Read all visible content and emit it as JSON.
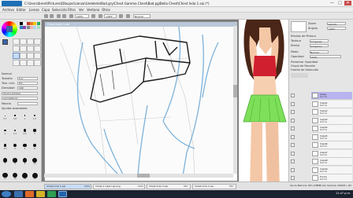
{
  "app": {
    "logo": "PaintTool SAI",
    "title": "C:\\Users\\brent\\Pictures\\Dibujos\\Lienzo\\Undelete\\Bad.gry\\Chest Gamma Chest\\Bad.pg\\Bella Chest\\Chest Inda 1.sai (*)"
  },
  "window_controls": {
    "minimize": "—",
    "maximize": "□",
    "close": "✕"
  },
  "menu": [
    "Archivo",
    "Editar",
    "Lienzo",
    "Capa",
    "Selección",
    "Filtro",
    "Ver",
    "Ventana",
    "Otros"
  ],
  "toolbar": {
    "zoom": "100%",
    "angle": "+000°",
    "mode": "Normal"
  },
  "colors": {
    "selected_primary": "#3a63a8",
    "selected_secondary": "#ffffff",
    "palette": [
      "#000000",
      "#ffffff",
      "#c0392b",
      "#e67e22",
      "#f1c40f",
      "#27ae60",
      "#2980b9",
      "#8e44ad",
      "#7f8c8d",
      "#f5b7b1",
      "#aed6f1",
      "#a9dfbf"
    ]
  },
  "tools": {
    "mode_label": "Normal",
    "size_label": "Tamaño",
    "size_value": "5.0",
    "min_size_label": "Tam. mín.",
    "min_size_value": "0%",
    "density_label": "Densidad",
    "density_value": "100",
    "shape_label": "(forma simple)",
    "texture_label": "(sin textura)",
    "blend_label": "Mezcla",
    "stabilizer_label": "Ayudas avanzadas",
    "brush_sizes": [
      "0.7",
      "0.8",
      "1",
      "1.5",
      "2",
      "2.3",
      "2.6",
      "3",
      "3.5",
      "4",
      "5",
      "6",
      "7",
      "8",
      "9",
      "10",
      "12",
      "14",
      "16",
      "20"
    ]
  },
  "canvas": {
    "tab_title": "Chest Inda 1.sai",
    "zoom": "100%"
  },
  "reference": {
    "description_hidden": ""
  },
  "right_panel": {
    "zoom_label": "Zoom",
    "zoom_value": "100.0%",
    "angle_label": "Ángulo",
    "angle_value": "+000°",
    "effects_label": "Efectos de Pintura",
    "texture_label": "Textura",
    "texture_value": "(ninguna)",
    "effect_label": "Efecto",
    "effect_value": "(ninguno)",
    "mode_label": "Modo",
    "mode_value": "Normal",
    "opacity_label": "Opacidad",
    "opacity_value": "100%",
    "preserve_opacity": "Preservar Opacidad",
    "clipping_group": "Grupo de Recorte",
    "selection_source": "Fuente de Selección",
    "layers": [
      {
        "name": "Línea",
        "mode": "Normal",
        "selected": true
      },
      {
        "name": "Capa1",
        "mode": "Normal",
        "selected": false
      },
      {
        "name": "Capa2",
        "mode": "Normal",
        "selected": false
      },
      {
        "name": "Capa3",
        "mode": "Normal",
        "selected": false
      },
      {
        "name": "Capa4",
        "mode": "Normal",
        "selected": false
      },
      {
        "name": "Capa5",
        "mode": "Normal",
        "selected": false
      },
      {
        "name": "Capa6",
        "mode": "Normal",
        "selected": false
      },
      {
        "name": "Capa7",
        "mode": "Normal",
        "selected": false
      },
      {
        "name": "Capa8",
        "mode": "Normal",
        "selected": false
      },
      {
        "name": "Capa9",
        "mode": "Normal",
        "selected": false
      },
      {
        "name": "Fondo",
        "mode": "Normal",
        "selected": false
      }
    ]
  },
  "document_tabs": [
    {
      "label": "Chest Inda 1.sai",
      "zoom": "100%",
      "selected": true
    },
    {
      "label": "Chest a Capt Lgt.png",
      "zoom": "100%",
      "selected": false
    },
    {
      "label": "Chest Inda 3.sai",
      "zoom": "50%",
      "selected": false
    },
    {
      "label": "Chest Inda 2.sai",
      "zoom": "50%",
      "selected": false
    }
  ],
  "status": {
    "memory": "Uso de Memoria: 30% (338MB) Uso memoria: 2%",
    "extra": "Shift + Ctrl"
  },
  "taskbar": {
    "clock": "11:47 p.m."
  }
}
